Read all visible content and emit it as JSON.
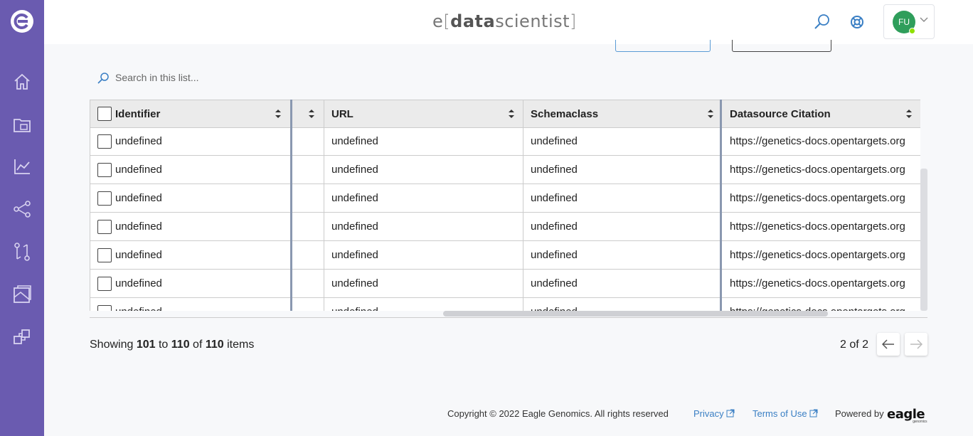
{
  "header": {
    "brand_e": "e",
    "brand_open": "[",
    "brand_data": "data",
    "brand_scientist": "scientist",
    "brand_close": "]",
    "user_initials": "FU"
  },
  "sidebar": {
    "items": [
      {
        "icon": "home-icon"
      },
      {
        "icon": "datasets-icon"
      },
      {
        "icon": "analytics-icon"
      },
      {
        "icon": "workflow-icon"
      },
      {
        "icon": "compare-icon"
      },
      {
        "icon": "catalog-icon"
      },
      {
        "icon": "integrations-icon"
      }
    ]
  },
  "search": {
    "placeholder": "Search in this list..."
  },
  "table": {
    "columns": [
      {
        "label": "Identifier"
      },
      {
        "label": ""
      },
      {
        "label": "URL"
      },
      {
        "label": "Schemaclass"
      },
      {
        "label": "Datasource Citation"
      }
    ],
    "rows": [
      {
        "identifier": "undefined",
        "url": "undefined",
        "schemaclass": "undefined",
        "citation": "https://genetics-docs.opentargets.org"
      },
      {
        "identifier": "undefined",
        "url": "undefined",
        "schemaclass": "undefined",
        "citation": "https://genetics-docs.opentargets.org"
      },
      {
        "identifier": "undefined",
        "url": "undefined",
        "schemaclass": "undefined",
        "citation": "https://genetics-docs.opentargets.org"
      },
      {
        "identifier": "undefined",
        "url": "undefined",
        "schemaclass": "undefined",
        "citation": "https://genetics-docs.opentargets.org"
      },
      {
        "identifier": "undefined",
        "url": "undefined",
        "schemaclass": "undefined",
        "citation": "https://genetics-docs.opentargets.org"
      },
      {
        "identifier": "undefined",
        "url": "undefined",
        "schemaclass": "undefined",
        "citation": "https://genetics-docs.opentargets.org"
      },
      {
        "identifier": "undefined",
        "url": "undefined",
        "schemaclass": "undefined",
        "citation": "https://genetics-docs.opentargets.org"
      }
    ]
  },
  "pagination": {
    "showing_prefix": "Showing",
    "from": "101",
    "to_word": "to",
    "to": "110",
    "of_word": "of",
    "total": "110",
    "items_word": "items",
    "page_info": "2 of 2"
  },
  "footer": {
    "copyright": "Copyright © 2022 Eagle Genomics. All rights reserved",
    "privacy": "Privacy",
    "terms": "Terms of Use",
    "powered_by": "Powered by",
    "logo_text": "eagle",
    "logo_sub": "genomics"
  },
  "colors": {
    "sidebar": "#6a5bb0",
    "link": "#3a7fc4",
    "avatar": "#2f9e5b"
  }
}
